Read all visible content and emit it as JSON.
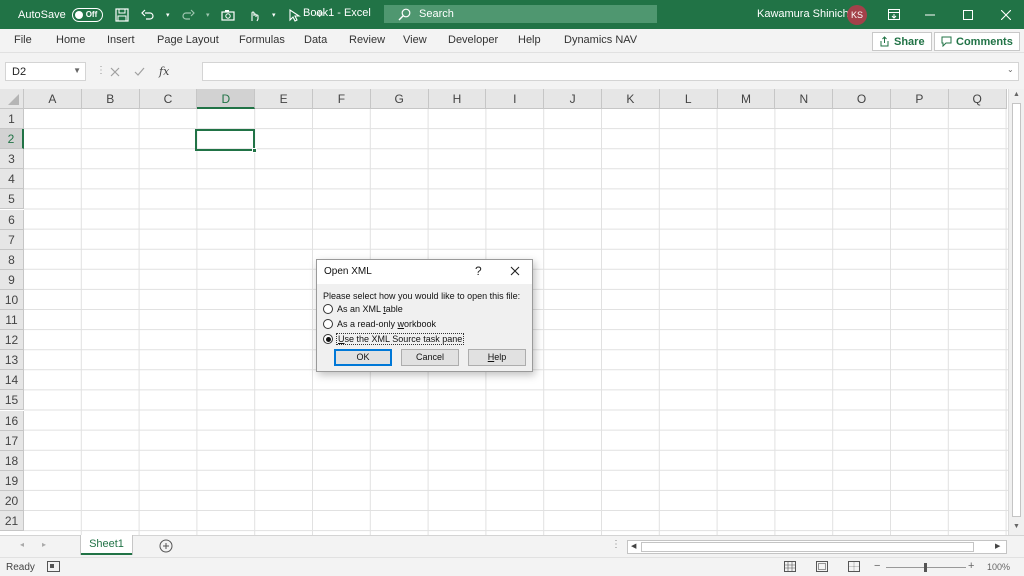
{
  "titlebar": {
    "autosave_label": "AutoSave",
    "autosave_state": "Off",
    "document_title": "Book1  -  Excel",
    "search_placeholder": "Search",
    "user_name": "Kawamura Shinichi",
    "user_initials": "KS",
    "bg_color": "#217346"
  },
  "menu": {
    "items": [
      "File",
      "Home",
      "Insert",
      "Page Layout",
      "Formulas",
      "Data",
      "Review",
      "View",
      "Developer",
      "Help",
      "Dynamics NAV"
    ],
    "share_label": "Share",
    "comments_label": "Comments"
  },
  "formula_bar": {
    "name_box": "D2",
    "fx_label": "fx",
    "formula_value": ""
  },
  "grid": {
    "columns": [
      "A",
      "B",
      "C",
      "D",
      "E",
      "F",
      "G",
      "H",
      "I",
      "J",
      "K",
      "L",
      "M",
      "N",
      "O",
      "P",
      "Q"
    ],
    "rows": [
      "1",
      "2",
      "3",
      "4",
      "5",
      "6",
      "7",
      "8",
      "9",
      "10",
      "11",
      "12",
      "13",
      "14",
      "15",
      "16",
      "17",
      "18",
      "19",
      "20",
      "21"
    ],
    "selected_column": "D",
    "selected_row": "2"
  },
  "sheets": {
    "tabs": [
      "Sheet1"
    ],
    "active": "Sheet1"
  },
  "statusbar": {
    "status": "Ready",
    "zoom": "100%"
  },
  "dialog": {
    "title": "Open XML",
    "help_glyph": "?",
    "prompt": "Please select how you would like to open this file:",
    "options": [
      {
        "pre": "As an XML ",
        "u": "t",
        "post": "able",
        "selected": false
      },
      {
        "pre": "As a read-only ",
        "u": "w",
        "post": "orkbook",
        "selected": false
      },
      {
        "pre": "",
        "u": "U",
        "post": "se the XML Source task pane",
        "selected": true
      }
    ],
    "ok_label": "OK",
    "cancel_label": "Cancel",
    "help_pre": "",
    "help_u": "H",
    "help_post": "elp"
  }
}
